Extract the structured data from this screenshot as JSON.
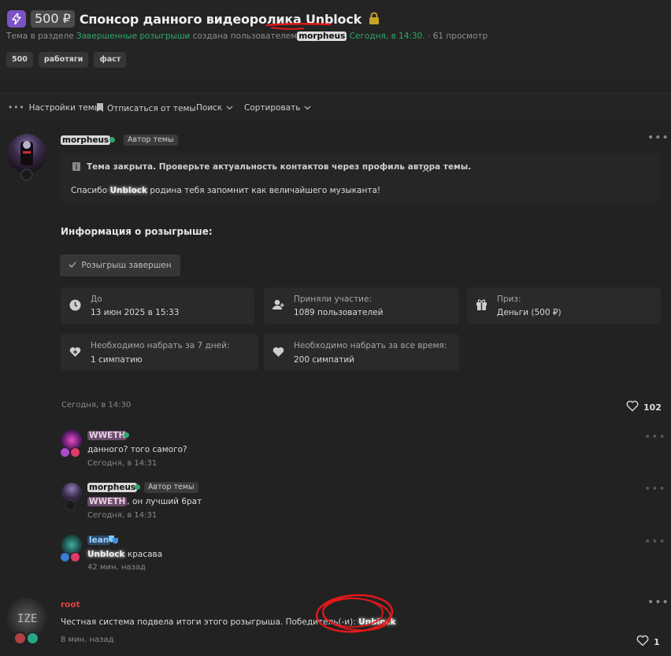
{
  "thread": {
    "price": "500 ₽",
    "title_prefix": "Спонсор данного видеоролика ",
    "title_name": "Unblock",
    "meta_prefix": "Тема в разделе",
    "meta_section": "Завершенные розыгрыши",
    "meta_created": "создана пользователем",
    "meta_user": "morpheus",
    "meta_date": "Сегодня, в 14:30.",
    "meta_views": "· 61 просмотр",
    "tags": [
      "500",
      "работяги",
      "фаст"
    ]
  },
  "toolbar": {
    "settings": "Настройки темы",
    "unsubscribe": "Отписаться от темы",
    "search": "Поиск",
    "sort": "Сортировать"
  },
  "first_post": {
    "author": "morpheus",
    "author_badge": "Автор темы",
    "closed_notice": "Тема закрыта. Проверьте актуальность контактов через профиль автора темы.",
    "text_before": "Спасибо ",
    "text_name": "Unblock",
    "text_after": " родина тебя запомнит как величайшего музыканта!",
    "info_title": "Информация о розыгрыше:",
    "status_button": "Розыгрыш завершен",
    "cards": [
      {
        "label": "До",
        "value": "13 июн 2025 в 15:33",
        "icon": "clock-icon"
      },
      {
        "label": "Приняли участие:",
        "value": "1089 пользователей",
        "icon": "users-icon"
      },
      {
        "label": "Приз:",
        "value": "Деньги (500 ₽)",
        "icon": "gift-icon"
      },
      {
        "label": "Необходимо набрать за 7 дней:",
        "value": "1 симпатию",
        "icon": "heart-plus-icon"
      },
      {
        "label": "Необходимо набрать за все время:",
        "value": "200 симпатий",
        "icon": "heart-icon"
      }
    ],
    "date": "Сегодня, в 14:30",
    "likes": "102"
  },
  "comments": [
    {
      "author": "WWETH",
      "text": "данного? того самого?",
      "time": "Сегодня, в 14:31"
    },
    {
      "author": "morpheus",
      "badge": "Автор темы",
      "mention": "WWETH",
      "text": ", он лучший 6рат",
      "time": "Сегодня, в 14:31"
    },
    {
      "author": "lean",
      "mention": "Unblock",
      "text": " красава",
      "time": "42 мин. назад"
    }
  ],
  "last_post": {
    "author": "root",
    "text": "Честная система подвела итоги этого розыгрыша. Победитель(-и): ",
    "winner": "Unblock",
    "time": "8 мин. назад",
    "likes": "1"
  },
  "colors": {
    "accent_green": "#2ea86a",
    "bolt_purple": "#7b53c7",
    "scribble_red": "#e0181b",
    "lock_gold": "#c9a227"
  }
}
